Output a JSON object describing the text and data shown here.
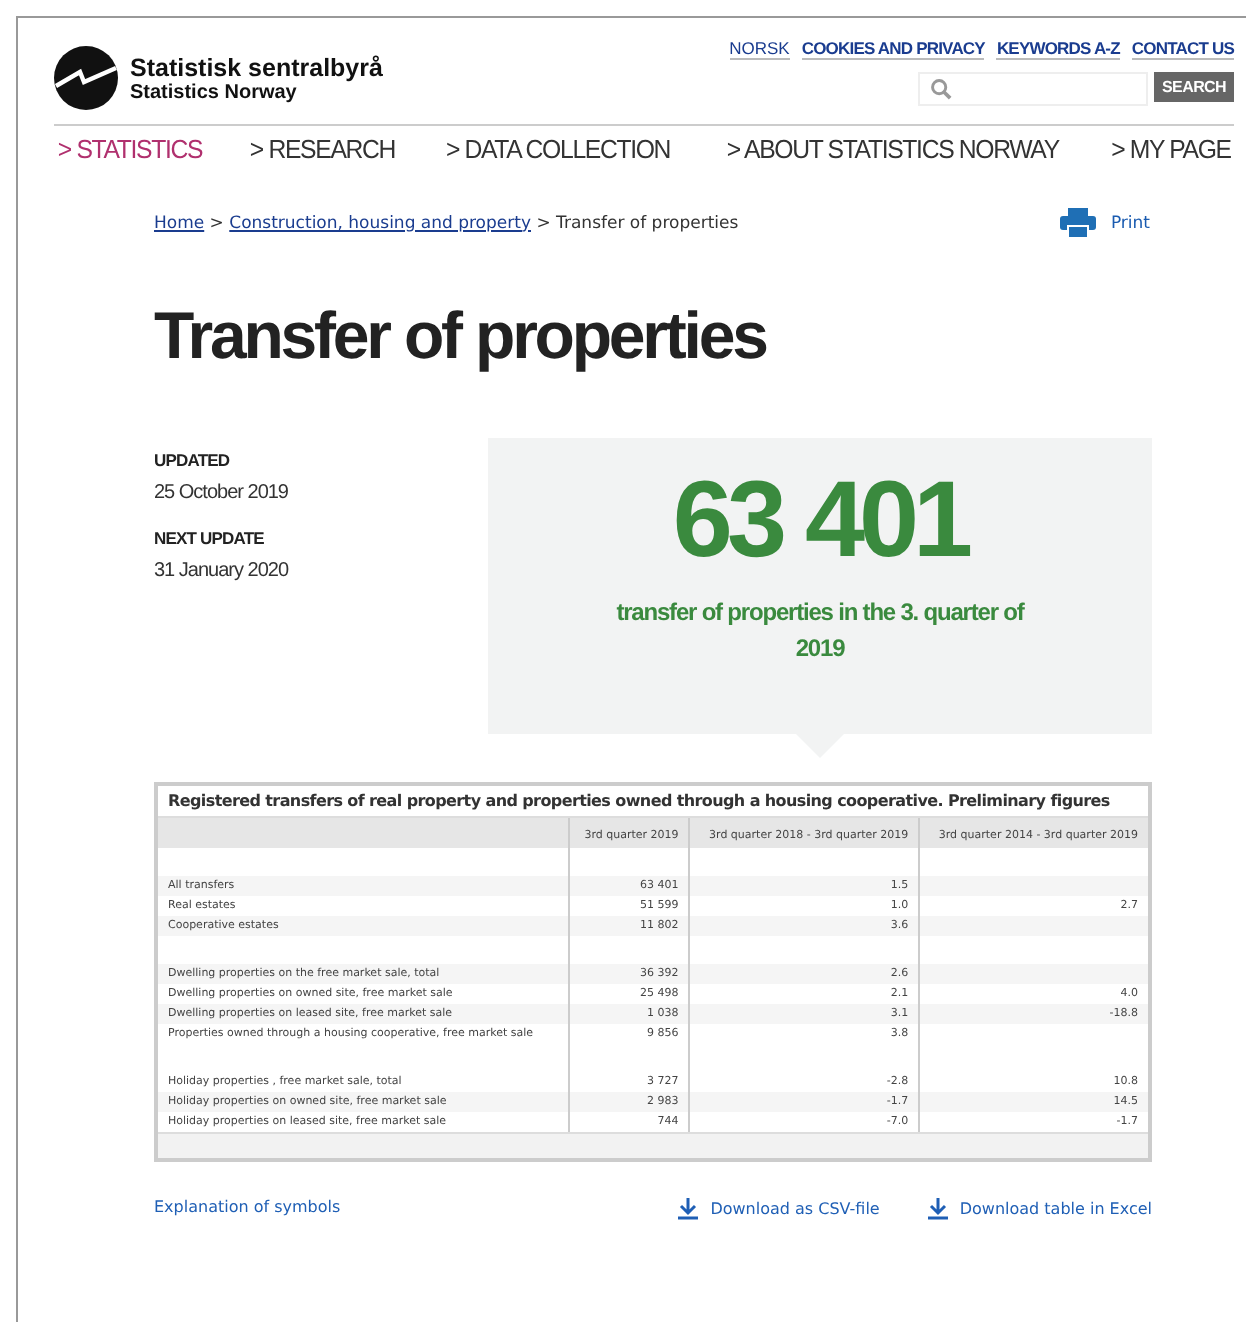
{
  "header": {
    "logo_name": "Statistisk sentralbyrå",
    "logo_subtitle": "Statistics Norway",
    "top_links": [
      "NORSK",
      "COOKIES AND PRIVACY",
      "KEYWORDS A-Z",
      "CONTACT US"
    ],
    "search": {
      "button": "SEARCH"
    }
  },
  "nav": [
    {
      "label": "> STATISTICS",
      "selected": true
    },
    {
      "label": "> RESEARCH",
      "selected": false
    },
    {
      "label": "> DATA COLLECTION",
      "selected": false
    },
    {
      "label": "> ABOUT STATISTICS NORWAY",
      "selected": false
    },
    {
      "label": "> MY PAGE",
      "selected": false
    }
  ],
  "breadcrumb": {
    "links": [
      "Home",
      "Construction, housing and property"
    ],
    "separator": ">",
    "current": "Transfer of properties"
  },
  "print": "Print",
  "title": "Transfer of properties",
  "meta": [
    {
      "label": "UPDATED",
      "value": "25 October 2019"
    },
    {
      "label": "NEXT UPDATE",
      "value": "31 January 2020"
    }
  ],
  "key_figure": {
    "value": "63 401",
    "caption": "transfer of properties in the 3. quarter of 2019"
  },
  "table": {
    "title": "Registered transfers of real property and properties owned through a housing cooperative. Preliminary figures",
    "columns": [
      "3rd quarter 2019",
      "3rd quarter 2018 - 3rd quarter 2019",
      "3rd quarter 2014 - 3rd quarter 2019"
    ],
    "rows": [
      {
        "kind": "blank"
      },
      {
        "kind": "data",
        "label": "All transfers",
        "cells": [
          "63 401",
          "1.5",
          ""
        ]
      },
      {
        "kind": "data",
        "label": "Real estates",
        "cells": [
          "51 599",
          "1.0",
          "2.7"
        ]
      },
      {
        "kind": "data",
        "label": "Cooperative estates",
        "cells": [
          "11 802",
          "3.6",
          ""
        ]
      },
      {
        "kind": "blank"
      },
      {
        "kind": "data",
        "label": "Dwelling properties on the free market sale, total",
        "cells": [
          "36 392",
          "2.6",
          ""
        ]
      },
      {
        "kind": "data",
        "label": "Dwelling properties on owned site, free market sale",
        "cells": [
          "25 498",
          "2.1",
          "4.0"
        ]
      },
      {
        "kind": "data",
        "label": "Dwelling properties on leased site, free market sale",
        "cells": [
          "1 038",
          "3.1",
          "-18.8"
        ]
      },
      {
        "kind": "data",
        "label": "Properties owned through a housing cooperative, free market sale",
        "cells": [
          "9 856",
          "3.8",
          ""
        ]
      },
      {
        "kind": "blank"
      },
      {
        "kind": "data",
        "label": "Holiday properties , free market sale, total",
        "cells": [
          "3 727",
          "-2.8",
          "10.8"
        ]
      },
      {
        "kind": "data",
        "label": "Holiday properties on owned site, free market sale",
        "cells": [
          "2 983",
          "-1.7",
          "14.5"
        ]
      },
      {
        "kind": "data",
        "label": "Holiday properties on leased site, free market sale",
        "cells": [
          "744",
          "-7.0",
          "-1.7"
        ]
      }
    ]
  },
  "footer": {
    "explanation": "Explanation of symbols",
    "downloads": [
      "Download as CSV-file",
      "Download table in Excel"
    ]
  }
}
